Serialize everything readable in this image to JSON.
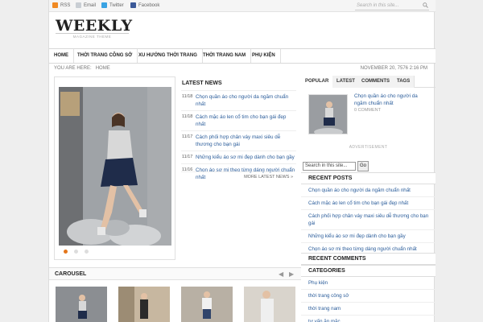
{
  "topbar": {
    "links": [
      {
        "label": "RSS",
        "icon": "rss-icon",
        "color": "#f08a24"
      },
      {
        "label": "Email",
        "icon": "email-icon",
        "color": "#9aa3ad"
      },
      {
        "label": "Twitter",
        "icon": "twitter-icon",
        "color": "#3aa3e3"
      },
      {
        "label": "Facebook",
        "icon": "facebook-icon",
        "color": "#3b5998"
      }
    ],
    "search_placeholder": "Search in this site..."
  },
  "logo": {
    "title": "WEEKLY",
    "subtitle": "MAGAZINE THEME"
  },
  "nav": {
    "items": [
      "HOME",
      "THỜI TRANG CÔNG SỞ",
      "XU HƯỚNG THỜI TRANG",
      "THỜI TRANG NAM",
      "PHỤ KIỆN"
    ]
  },
  "breadcrumb": {
    "prefix": "YOU ARE HERE:",
    "home": "HOME"
  },
  "date": "NOVEMBER 20, 7576 2:16 PM",
  "slider": {
    "dots": 3,
    "active": 0
  },
  "latest": {
    "title": "LATEST NEWS",
    "items": [
      {
        "date": "11/18",
        "title": "Chọn quần áo cho người da ngăm chuẩn nhất"
      },
      {
        "date": "11/18",
        "title": "Cách mặc áo len cổ tim cho bạn gái đẹp nhất"
      },
      {
        "date": "11/17",
        "title": "Cách phối hợp chân váy maxi siêu dễ thương cho bạn gái"
      },
      {
        "date": "11/17",
        "title": "Những kiểu áo sơ mi đẹp dành cho bạn gầy"
      },
      {
        "date": "11/16",
        "title": "Chọn áo sơ mi theo từng dáng người chuẩn nhất"
      }
    ],
    "more": "MORE LATEST NEWS »"
  },
  "carousel": {
    "title": "CAROUSEL",
    "prev": "◀",
    "next": "▶"
  },
  "sidebar": {
    "tabs": [
      "POPULAR",
      "LATEST",
      "COMMENTS",
      "TAGS"
    ],
    "popular": {
      "title": "Chọn quần áo cho người da ngăm chuẩn nhất",
      "comments": "0 COMMENT"
    },
    "ad_label": "ADVERTISEMENT",
    "search_value": "Search in this site...",
    "search_button": "Go",
    "recent_posts_title": "RECENT POSTS",
    "recent_posts": [
      "Chọn quần áo cho người da ngăm chuẩn nhất",
      "Cách mặc áo len cổ tim cho bạn gái đẹp nhất",
      "Cách phối hợp chân váy maxi siêu dễ thương cho bạn gái",
      "Những kiểu áo sơ mi đẹp dành cho bạn gầy",
      "Chọn áo sơ mi theo từng dáng người chuẩn nhất"
    ],
    "recent_comments_title": "RECENT COMMENTS",
    "categories_title": "CATEGORIES",
    "categories": [
      "Phụ kiện",
      "thời trang công sở",
      "thời trang nam",
      "tư vấn ăn mặc"
    ]
  }
}
